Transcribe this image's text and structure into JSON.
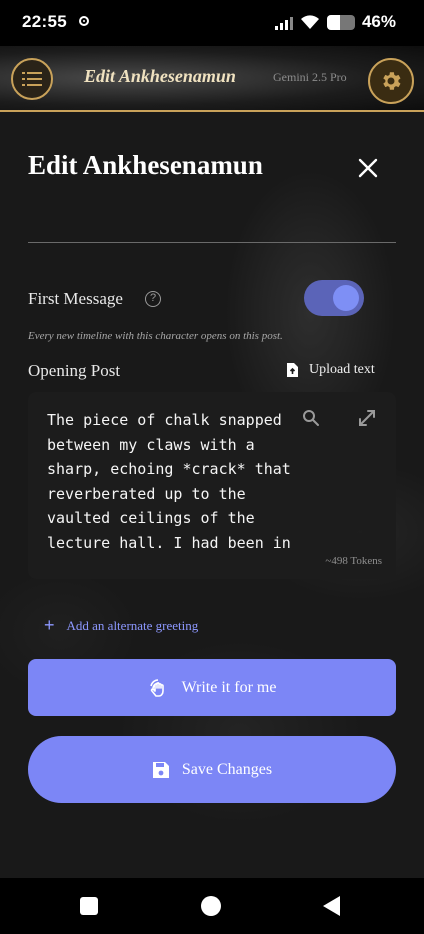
{
  "status_bar": {
    "time": "22:55",
    "battery": "46%"
  },
  "app_bar": {
    "title": "Edit Ankhesenamun",
    "model": "Gemini 2.5 Pro"
  },
  "dialog": {
    "heading": "Edit Ankhesenamun",
    "first_message": {
      "label": "First Message",
      "enabled": true,
      "description": "Every new timeline with this character opens on this post."
    },
    "opening_post": {
      "label": "Opening Post",
      "upload_label": "Upload text",
      "text": "The piece of chalk snapped between my claws with a sharp, echoing *crack* that reverberated up to the vaulted ceilings of the lecture hall. I had been in the middle of charting a",
      "tokens": "~498 Tokens"
    },
    "alt_greeting_label": "Add an alternate greeting",
    "write_button_label": "Write it for me",
    "save_button_label": "Save Changes"
  },
  "colors": {
    "accent": "#7c86f6",
    "gold": "#c9a25a",
    "link": "#8d98ff"
  }
}
